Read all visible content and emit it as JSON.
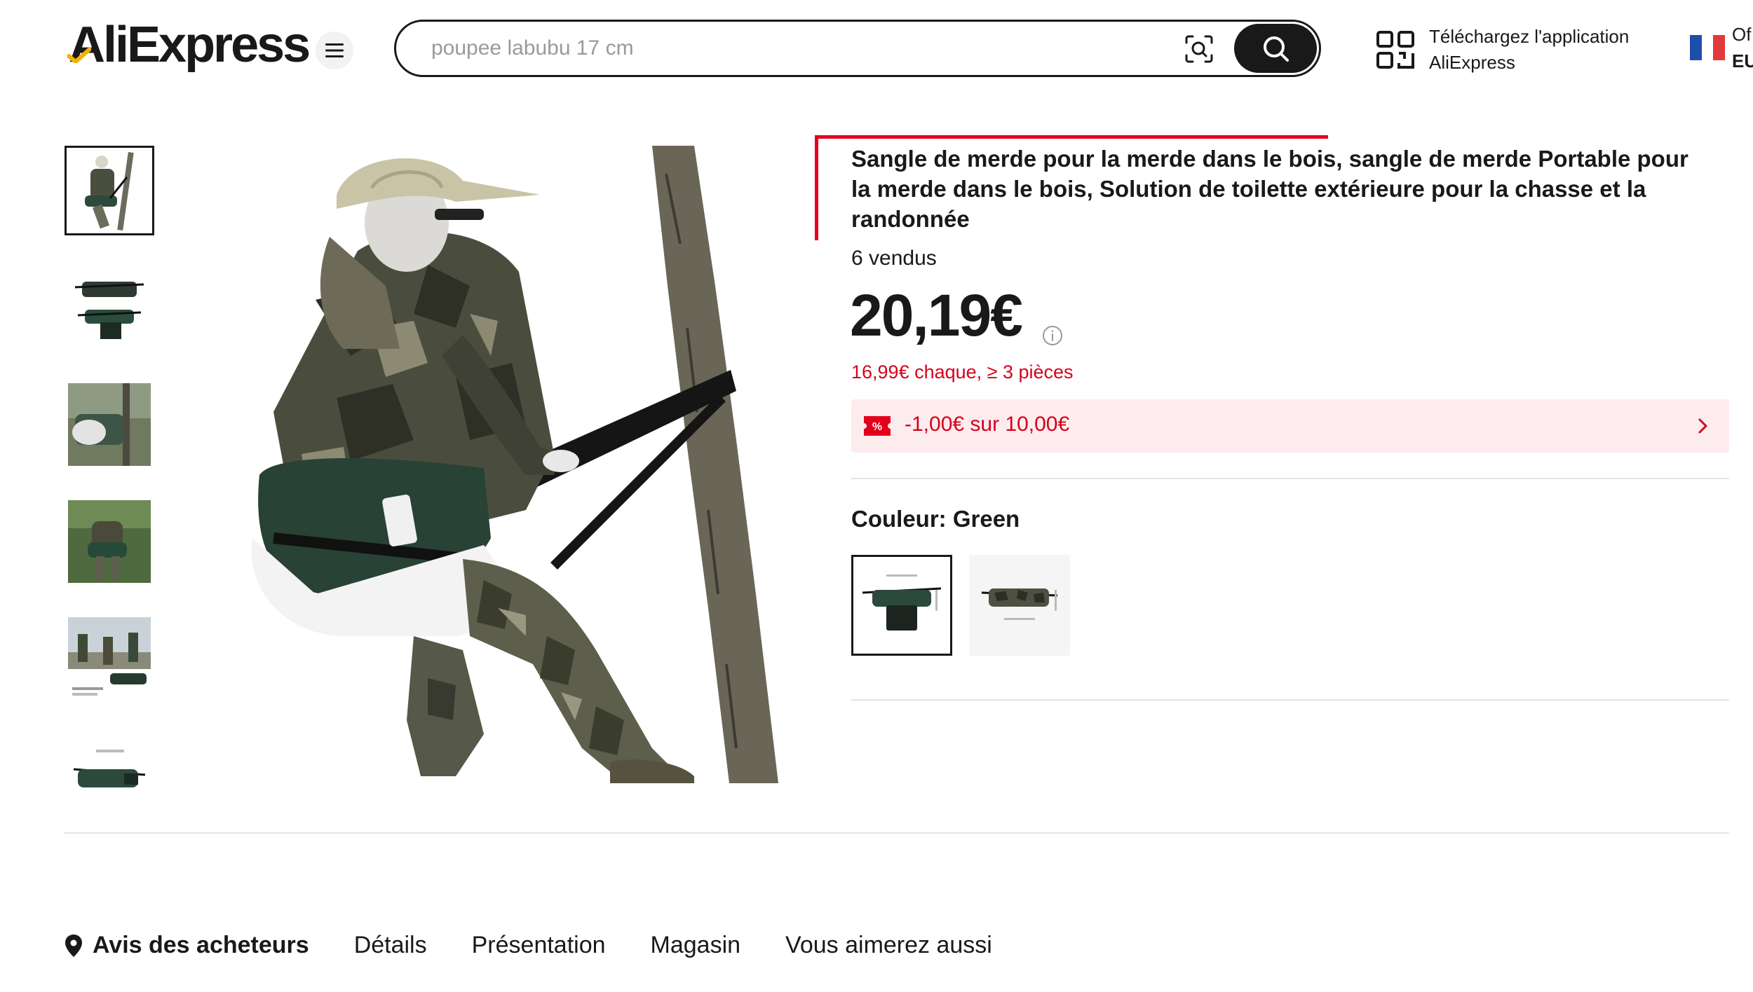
{
  "header": {
    "logo": "AliExpress",
    "search_placeholder": "poupee labubu 17 cm",
    "app_download_line1": "Téléchargez l'application",
    "app_download_line2": "AliExpress",
    "locale_line1": "Of",
    "locale_line2": "EU",
    "icons": {
      "menu": "hamburger-icon",
      "camera": "image-search-icon",
      "search": "magnifier-icon",
      "qr": "qr-code-icon"
    }
  },
  "gallery": {
    "thumbnail_count": 6,
    "selected_index": 0
  },
  "product": {
    "title": "Sangle de merde pour la merde dans le bois, sangle de merde Portable pour la merde dans le bois, Solution de toilette extérieure pour la chasse et la randonnée",
    "sold": "6 vendus",
    "price": "20,19€",
    "bulk_price": "16,99€ chaque, ≥ 3 pièces",
    "coupon_text": "-1,00€ sur 10,00€",
    "coupon_badge": "%",
    "color_label": "Couleur: Green",
    "color_options": [
      "Green",
      "Camo"
    ],
    "selected_color_index": 0
  },
  "tabs": [
    {
      "label": "Avis des acheteurs",
      "active": true
    },
    {
      "label": "Détails",
      "active": false
    },
    {
      "label": "Présentation",
      "active": false
    },
    {
      "label": "Magasin",
      "active": false
    },
    {
      "label": "Vous aimerez aussi",
      "active": false
    }
  ],
  "colors": {
    "accent_red": "#d3031c",
    "annotation_red": "#e3001b",
    "coupon_bg": "#fdecee",
    "text": "#191919",
    "logo_tick": "#f2b100",
    "flag_blue": "#1f4ea8",
    "flag_red": "#e23a3a"
  }
}
